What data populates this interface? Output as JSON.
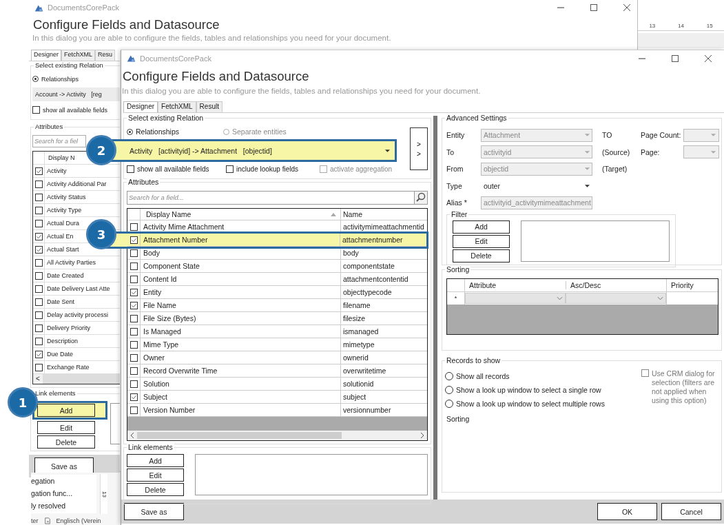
{
  "desktop": {
    "ruler_marks": [
      "13",
      "14",
      "15"
    ],
    "document_lines": [
      "egation",
      "gation func...",
      "ly resolved"
    ],
    "vertical_ruler": "13",
    "status_items": [
      "ter",
      "Englisch (Verein"
    ]
  },
  "back_window": {
    "app_name": "DocumentsCorePack",
    "title": "Configure Fields and Datasource",
    "subtitle": "In this dialog you are able to configure the fields, tables and relationships you need for your document.",
    "tabs": [
      {
        "label": "Designer",
        "selected": true
      },
      {
        "label": "FetchXML",
        "selected": false
      },
      {
        "label": "Resu",
        "selected": false
      }
    ],
    "relation_group": "Select existing Relation",
    "radio": {
      "label": "Relationships",
      "selected": true
    },
    "relation": "Account -> Activity   [reg",
    "show_all": {
      "label": "show all available fields",
      "checked": false
    },
    "attributes_group": "Attributes",
    "search_placeholder": "Search for a fiel",
    "column": "Display N",
    "rows": [
      {
        "name": "Activity",
        "checked": true
      },
      {
        "name": "Activity Additional Par",
        "checked": false
      },
      {
        "name": "Activity Status",
        "checked": false
      },
      {
        "name": "Activity Type",
        "checked": false
      },
      {
        "name": "Actual Dura",
        "checked": false
      },
      {
        "name": "Actual En",
        "checked": true
      },
      {
        "name": "Actual Start",
        "checked": true
      },
      {
        "name": "All Activity Parties",
        "checked": false
      },
      {
        "name": "Date Created",
        "checked": false
      },
      {
        "name": "Date Delivery Last Atte",
        "checked": false
      },
      {
        "name": "Date Sent",
        "checked": false
      },
      {
        "name": "Delay activity processi",
        "checked": false
      },
      {
        "name": "Delivery Priority",
        "checked": false
      },
      {
        "name": "Description",
        "checked": false
      },
      {
        "name": "Due Date",
        "checked": true
      },
      {
        "name": "Exchange Rate",
        "checked": false
      }
    ],
    "scroll_glyph": "<",
    "link_group": "Link elements",
    "link_buttons": [
      {
        "label": "Add",
        "highlighted": true
      },
      {
        "label": "Edit",
        "highlighted": false
      },
      {
        "label": "Delete",
        "highlighted": false
      }
    ],
    "save_button": "Save as"
  },
  "window": {
    "app_name": "DocumentsCorePack",
    "title": "Configure Fields and Datasource",
    "subtitle": "In this dialog you are able to configure the fields, tables and relationships you need for your document.",
    "tabs": [
      {
        "label": "Designer",
        "selected": true
      },
      {
        "label": "FetchXML",
        "selected": false
      },
      {
        "label": "Result",
        "selected": false
      }
    ],
    "relation_group": "Select existing Relation",
    "relation_modes": [
      {
        "label": "Relationships",
        "selected": true,
        "disabled": false
      },
      {
        "label": "Separate entities",
        "selected": false,
        "disabled": true
      }
    ],
    "relation": {
      "value": "Activity   [activityid] -> Attachment   [objectid]",
      "highlighted": true
    },
    "expand_glyphs": [
      ">",
      ">"
    ],
    "options": [
      {
        "label": "show all available fields",
        "checked": false,
        "disabled": false
      },
      {
        "label": "include lookup fields",
        "checked": false,
        "disabled": false
      },
      {
        "label": "activate aggregation",
        "checked": false,
        "disabled": true
      }
    ],
    "attributes_group": "Attributes",
    "search_placeholder": "Search for a field...",
    "columns": [
      "Display Name",
      "Name"
    ],
    "rows": [
      {
        "display": "Activity Mime Attachment",
        "name": "activitymimeattachmentid",
        "checked": false,
        "highlighted": false
      },
      {
        "display": "Attachment Number",
        "name": "attachmentnumber",
        "checked": true,
        "highlighted": true
      },
      {
        "display": "Body",
        "name": "body",
        "checked": false,
        "highlighted": false
      },
      {
        "display": "Component State",
        "name": "componentstate",
        "checked": false,
        "highlighted": false
      },
      {
        "display": "Content Id",
        "name": "attachmentcontentid",
        "checked": false,
        "highlighted": false
      },
      {
        "display": "Entity",
        "name": "objecttypecode",
        "checked": true,
        "highlighted": false
      },
      {
        "display": "File Name",
        "name": "filename",
        "checked": true,
        "highlighted": false
      },
      {
        "display": "File Size (Bytes)",
        "name": "filesize",
        "checked": false,
        "highlighted": false
      },
      {
        "display": "Is Managed",
        "name": "ismanaged",
        "checked": false,
        "highlighted": false
      },
      {
        "display": "Mime Type",
        "name": "mimetype",
        "checked": false,
        "highlighted": false
      },
      {
        "display": "Owner",
        "name": "ownerid",
        "checked": false,
        "highlighted": false
      },
      {
        "display": "Record Overwrite Time",
        "name": "overwritetime",
        "checked": false,
        "highlighted": false
      },
      {
        "display": "Solution",
        "name": "solutionid",
        "checked": false,
        "highlighted": false
      },
      {
        "display": "Subject",
        "name": "subject",
        "checked": true,
        "highlighted": false
      },
      {
        "display": "Version Number",
        "name": "versionnumber",
        "checked": false,
        "highlighted": false
      }
    ],
    "link_group": "Link elements",
    "link_buttons": [
      "Add",
      "Edit",
      "Delete"
    ],
    "advanced": {
      "title": "Advanced Settings",
      "fields": [
        {
          "label": "Entity",
          "value": "Attachment",
          "kind": "combo",
          "disabled": true,
          "note": "TO"
        },
        {
          "label": "To",
          "value": "activityid",
          "kind": "combo",
          "disabled": true,
          "note": "(Source)"
        },
        {
          "label": "From",
          "value": "objectid",
          "kind": "combo",
          "disabled": true,
          "note": "(Target)"
        },
        {
          "label": "Type",
          "value": "outer",
          "kind": "dropdown",
          "disabled": false
        },
        {
          "label": "Alias *",
          "value": "activityid_activitymimeattachment",
          "kind": "text",
          "disabled": true
        }
      ],
      "paging": [
        "Page Count:",
        "Page:"
      ],
      "filter": {
        "title": "Filter",
        "buttons": [
          "Add",
          "Edit",
          "Delete"
        ]
      },
      "sorting": {
        "title": "Sorting",
        "columns": [
          "Attribute",
          "Asc/Desc",
          "Priority"
        ],
        "new_row": "*"
      },
      "records": {
        "title": "Records to show",
        "options": [
          {
            "label": "Show all records",
            "selected": false
          },
          {
            "label": "Show a look up window to select a single row",
            "selected": false
          },
          {
            "label": "Show a look up window to select multiple rows",
            "selected": false
          }
        ],
        "crm_dialog": {
          "label": "Use CRM dialog for selection (filters are not applied when using this option)",
          "checked": false
        },
        "sorting_label": "Sorting"
      }
    },
    "buttons": {
      "save": "Save as",
      "ok": "OK",
      "cancel": "Cancel"
    }
  },
  "callouts": [
    {
      "number": "1"
    },
    {
      "number": "2"
    },
    {
      "number": "3"
    }
  ]
}
